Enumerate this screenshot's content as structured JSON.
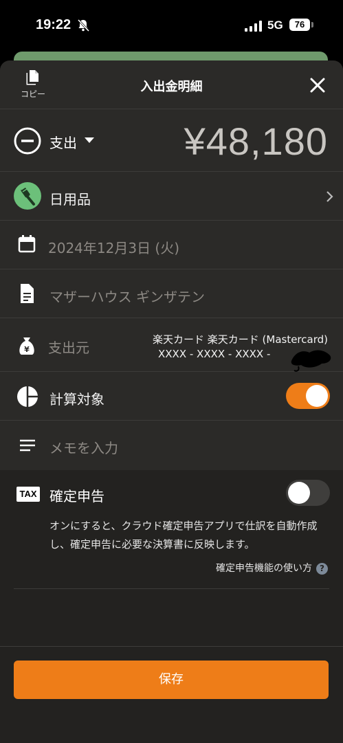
{
  "status_bar": {
    "time": "19:22",
    "network": "5G",
    "battery": "76"
  },
  "header": {
    "copy_label": "コピー",
    "title": "入出金明細"
  },
  "transaction": {
    "type_label": "支出",
    "amount": "¥48,180"
  },
  "category": {
    "label": "日用品"
  },
  "date": {
    "value": "2024年12月3日 (火)"
  },
  "shop": {
    "value": "マザーハウス ギンザテン"
  },
  "source": {
    "label": "支出元",
    "account_line1": "楽天カード 楽天カード (Mastercard)",
    "account_line2": "XXXX - XXXX - XXXX -"
  },
  "calculation": {
    "label": "計算対象",
    "enabled": true
  },
  "memo": {
    "placeholder": "メモを入力"
  },
  "tax": {
    "badge": "TAX",
    "label": "確定申告",
    "enabled": false,
    "description": "オンにすると、クラウド確定申告アプリで仕訳を自動作成し、確定申告に必要な決算書に反映します。",
    "help_link": "確定申告機能の使い方",
    "help_icon": "?"
  },
  "footer": {
    "save_label": "保存"
  },
  "colors": {
    "accent": "#ee7d18",
    "category_icon_bg": "#6cc07a",
    "sheet_bg": "#2b2a28"
  }
}
